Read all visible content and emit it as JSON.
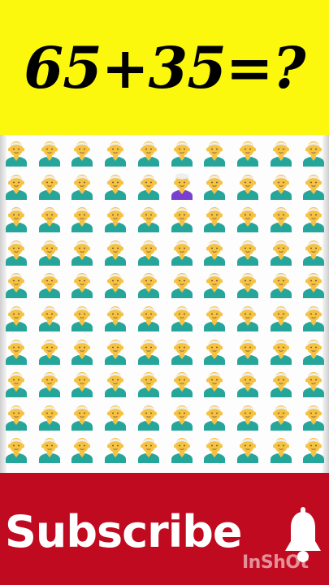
{
  "puzzle": {
    "question": "65+35=?",
    "rows": 10,
    "columns": 10,
    "base_emoji": "man-white-hair-emoji",
    "odd_emoji": "woman-white-hair-emoji",
    "odd_position": {
      "row": 2,
      "column": 6
    }
  },
  "banner": {
    "label": "Subscribe",
    "icon": "bell-icon"
  },
  "watermark": {
    "text": "InShOt"
  },
  "colors": {
    "header_bg": "#fbf80e",
    "banner_bg": "#c00a1f",
    "skin": "#f5c242",
    "hair": "#eeeeee",
    "shirt_man": "#26a69a",
    "shirt_woman": "#7b3fd0"
  }
}
